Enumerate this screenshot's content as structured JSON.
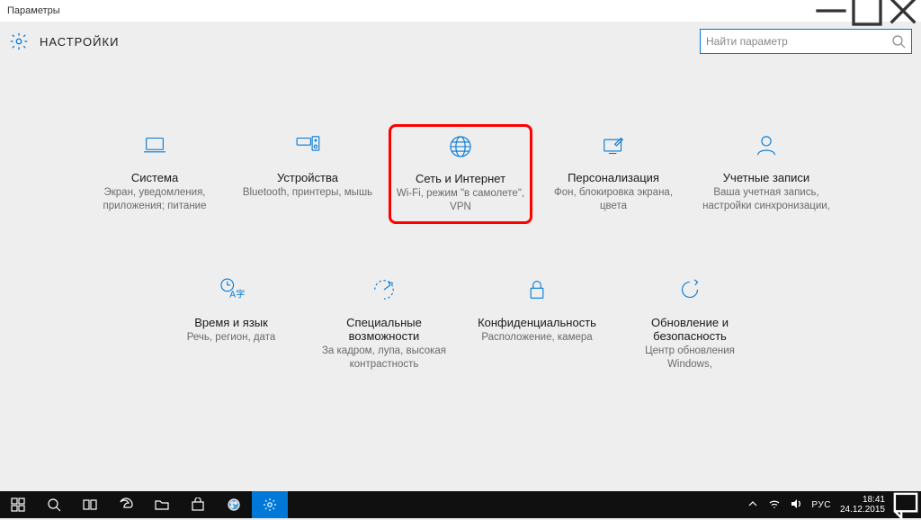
{
  "window": {
    "title": "Параметры"
  },
  "header": {
    "title": "НАСТРОЙКИ"
  },
  "search": {
    "placeholder": "Найти параметр"
  },
  "tiles": [
    {
      "title": "Система",
      "sub": "Экран, уведомления, приложения; питание"
    },
    {
      "title": "Устройства",
      "sub": "Bluetooth, принтеры, мышь"
    },
    {
      "title": "Сеть и Интернет",
      "sub": "Wi-Fi, режим \"в самолете\", VPN"
    },
    {
      "title": "Персонализация",
      "sub": "Фон, блокировка экрана, цвета"
    },
    {
      "title": "Учетные записи",
      "sub": "Ваша учетная запись, настройки синхронизации,"
    },
    {
      "title": "Время и язык",
      "sub": "Речь, регион, дата"
    },
    {
      "title": "Специальные возможности",
      "sub": "За кадром, лупа, высокая контрастность"
    },
    {
      "title": "Конфиденциальность",
      "sub": "Расположение, камера"
    },
    {
      "title": "Обновление и безопасность",
      "sub": "Центр обновления Windows,"
    }
  ],
  "taskbar": {
    "lang": "РУС",
    "time": "18:41",
    "date": "24.12.2015"
  }
}
